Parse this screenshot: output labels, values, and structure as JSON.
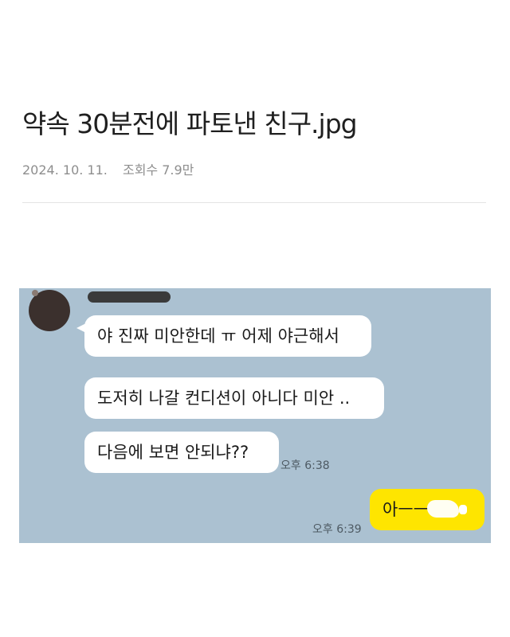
{
  "post": {
    "title": "약속 30분전에 파토낸 친구.jpg",
    "date": "2024. 10. 11.",
    "views": "조회수 7.9만"
  },
  "chat": {
    "background": "#abc1d1",
    "received": [
      {
        "text": "야 진짜 미안한데 ㅠ 어제 야근해서"
      },
      {
        "text": "도저히 나갈 컨디션이 아니다 미안 .."
      },
      {
        "text": "다음에 보면 안되냐??"
      }
    ],
    "received_time": "오후 6:38",
    "sent": {
      "text": "아ㅡㅡ",
      "color": "#fee500"
    },
    "sent_time": "오후 6:39"
  }
}
